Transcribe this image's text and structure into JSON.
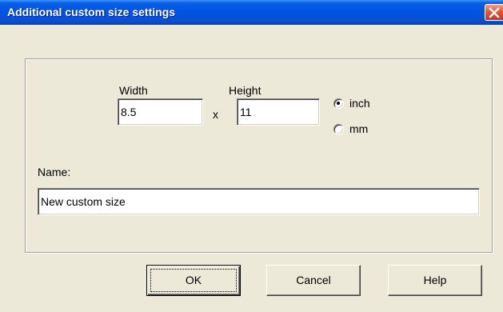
{
  "window": {
    "title": "Additional custom size settings",
    "close_icon": "close-icon"
  },
  "size": {
    "width_label": "Width",
    "width_value": "8.5",
    "times_label": "x",
    "height_label": "Height",
    "height_value": "11"
  },
  "units": {
    "selected": "inch",
    "options": [
      {
        "label": "inch",
        "checked": true
      },
      {
        "label": "mm",
        "checked": false
      }
    ]
  },
  "name": {
    "label": "Name:",
    "value": "New custom size"
  },
  "buttons": {
    "ok": "OK",
    "cancel": "Cancel",
    "help": "Help"
  },
  "colors": {
    "titlebar": "#0054E3",
    "dialog_bg": "#ECE9D8",
    "close_button": "#E2583A"
  }
}
